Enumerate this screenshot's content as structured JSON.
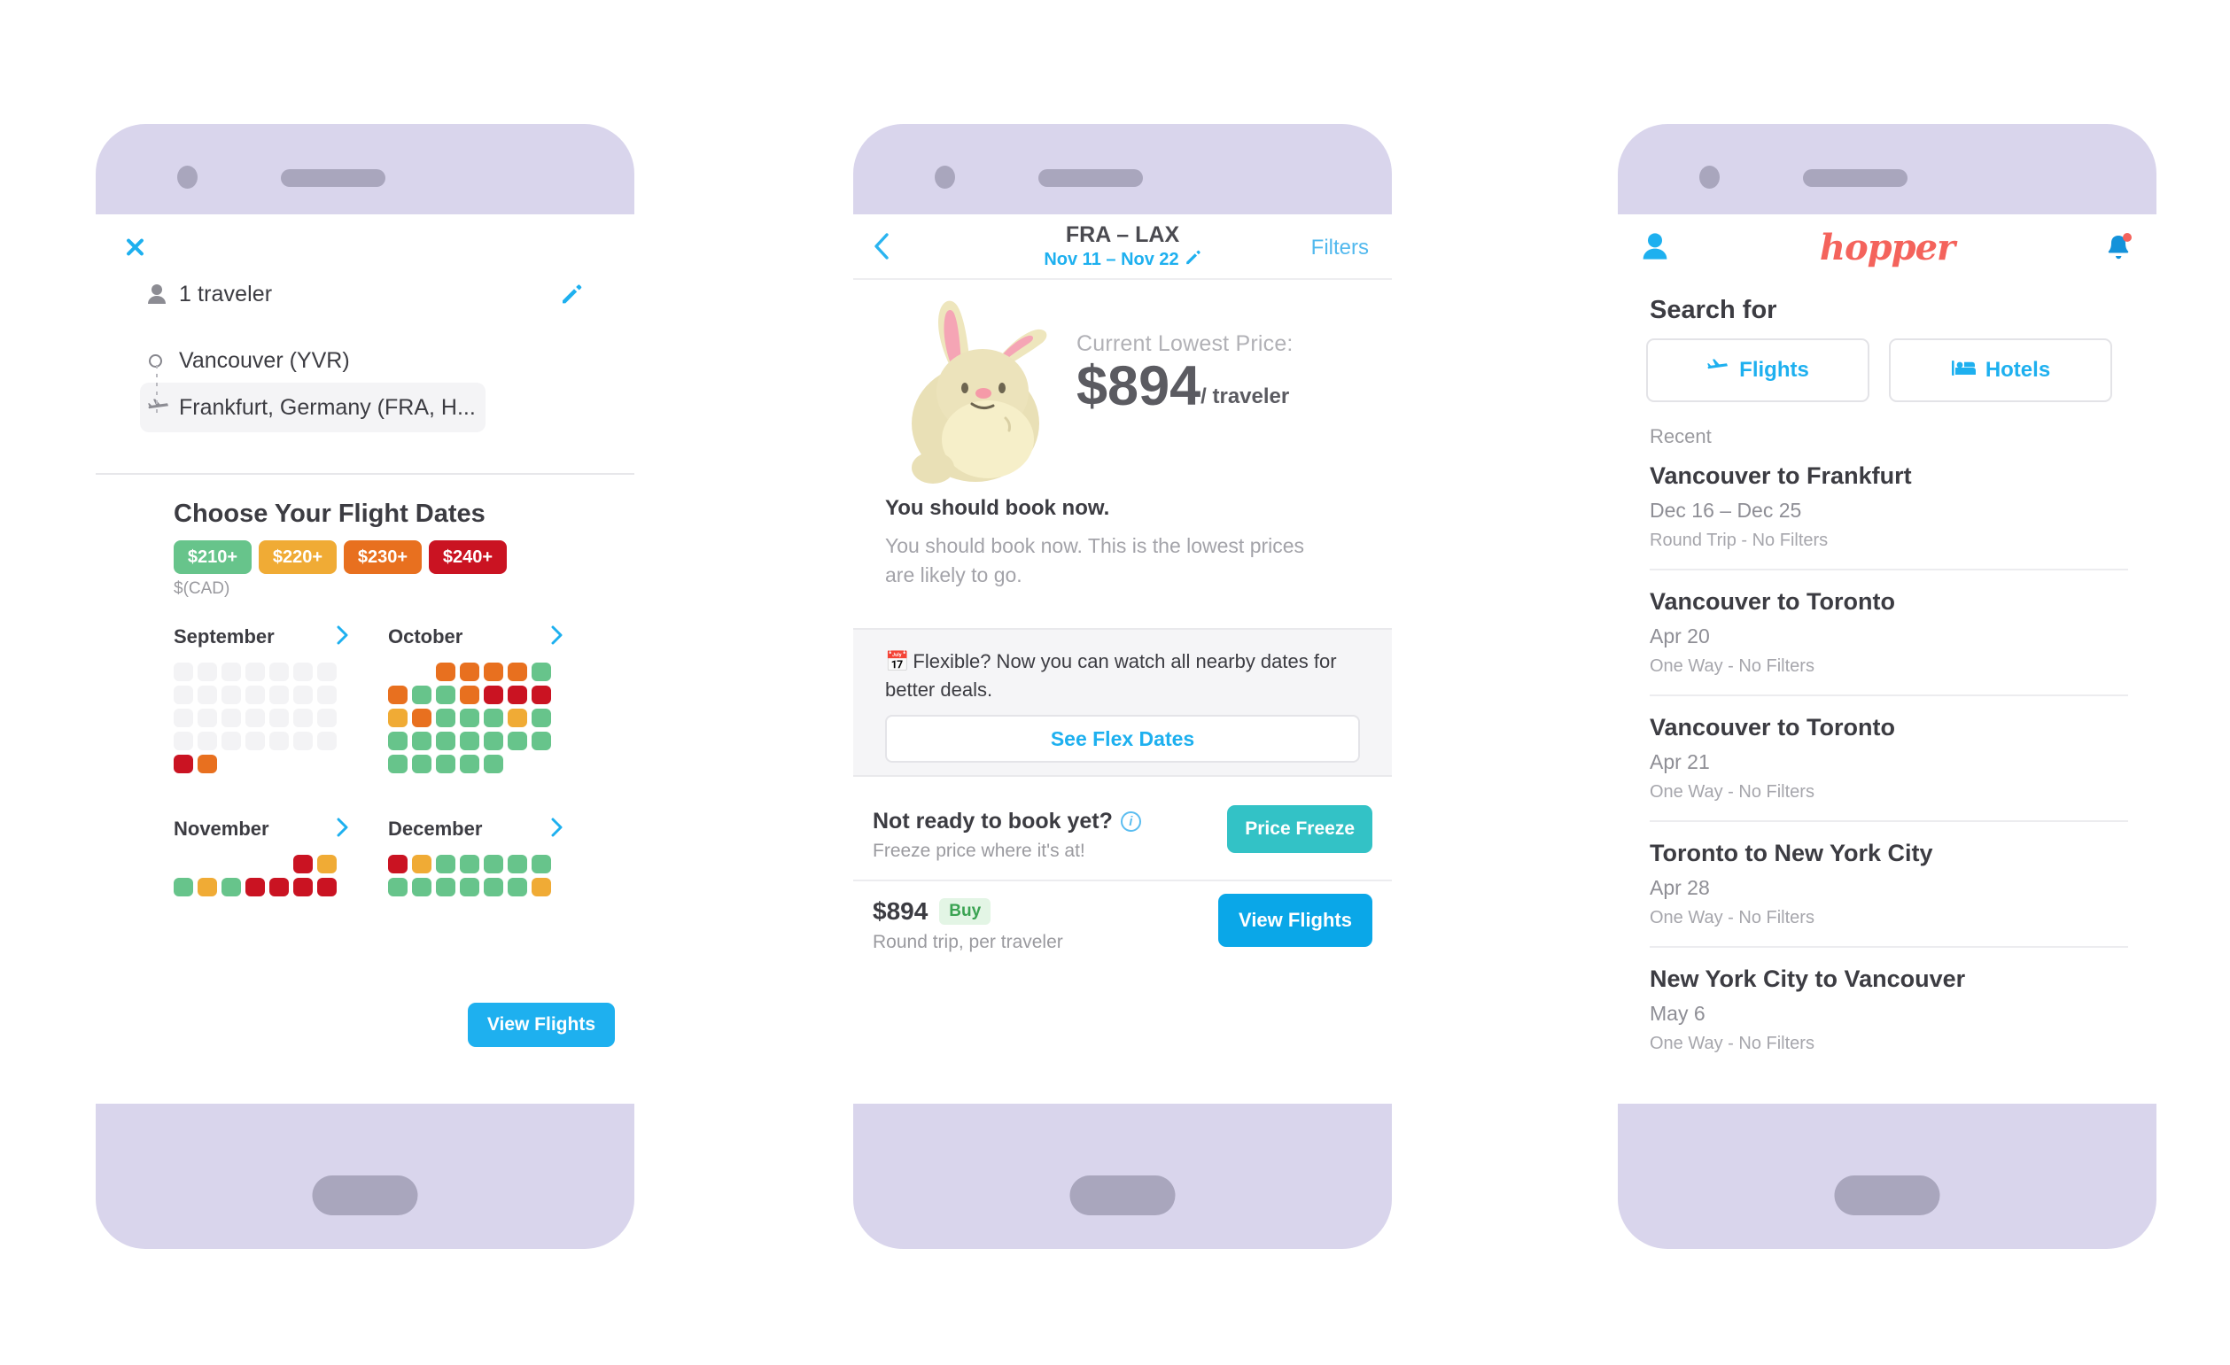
{
  "phone1": {
    "close_icon": "close-icon",
    "traveler": {
      "label": "1 traveler",
      "person_icon": "person-icon",
      "edit_icon": "pencil-icon"
    },
    "route": {
      "origin": "Vancouver (YVR)",
      "destination": "Frankfurt, Germany (FRA, H...",
      "origin_icon": "circle-icon",
      "dest_icon": "airplane-icon"
    },
    "calendar_title": "Choose Your Flight Dates",
    "legend": [
      {
        "label": "$210+",
        "color": "#67c48b"
      },
      {
        "label": "$220+",
        "color": "#f0ab35"
      },
      {
        "label": "$230+",
        "color": "#e8701f"
      },
      {
        "label": "$240+",
        "color": "#ca1322"
      }
    ],
    "currency_note": "$(CAD)",
    "months": [
      {
        "name": "September",
        "chevron_icon": "chevron-right-icon",
        "rows": [
          [
            "empty",
            "empty",
            "empty",
            "empty",
            "empty",
            "empty",
            "empty"
          ],
          [
            "empty",
            "empty",
            "empty",
            "empty",
            "empty",
            "empty",
            "empty"
          ],
          [
            "empty",
            "empty",
            "empty",
            "empty",
            "empty",
            "empty",
            "empty"
          ],
          [
            "empty",
            "empty",
            "empty",
            "empty",
            "empty",
            "empty",
            "empty"
          ],
          [
            "red",
            "orange",
            "blank",
            "blank",
            "blank",
            "blank",
            "blank"
          ]
        ]
      },
      {
        "name": "October",
        "chevron_icon": "chevron-right-icon",
        "rows": [
          [
            "blank",
            "blank",
            "orange",
            "orange",
            "orange",
            "orange",
            "green"
          ],
          [
            "orange",
            "green",
            "green",
            "orange",
            "red",
            "red",
            "red"
          ],
          [
            "yellow",
            "orange",
            "green",
            "green",
            "green",
            "yellow",
            "green"
          ],
          [
            "green",
            "green",
            "green",
            "green",
            "green",
            "green",
            "green"
          ],
          [
            "green",
            "green",
            "green",
            "green",
            "green",
            "blank",
            "blank"
          ]
        ]
      },
      {
        "name": "November",
        "chevron_icon": "chevron-right-icon",
        "rows": [
          [
            "blank",
            "blank",
            "blank",
            "blank",
            "blank",
            "red",
            "yellow"
          ],
          [
            "green",
            "yellow",
            "green",
            "red",
            "red",
            "red",
            "red"
          ]
        ]
      },
      {
        "name": "December",
        "chevron_icon": "chevron-right-icon",
        "rows": [
          [
            "red",
            "yellow",
            "green",
            "green",
            "green",
            "green",
            "green"
          ],
          [
            "green",
            "green",
            "green",
            "green",
            "green",
            "green",
            "yellow"
          ]
        ]
      }
    ],
    "view_flights_label": "View Flights"
  },
  "phone2": {
    "header": {
      "back_icon": "chevron-left-icon",
      "title": "FRA – LAX",
      "dates": "Nov 11 – Nov 22",
      "edit_icon": "pencil-icon",
      "filters_label": "Filters"
    },
    "price": {
      "caption": "Current Lowest Price:",
      "amount": "$894",
      "unit": "/ traveler",
      "mascot_icon": "bunny-mascot-icon"
    },
    "advice": {
      "title": "You should book now.",
      "body": "You should book now. This is the lowest prices are likely to go."
    },
    "flex": {
      "calendar_icon": "calendar-icon",
      "text": "Flexible? Now you can watch all nearby dates for better deals.",
      "button_label": "See Flex Dates"
    },
    "freeze": {
      "title": "Not ready to book yet?",
      "info_icon": "info-icon",
      "subtitle": "Freeze price where it's at!",
      "button_label": "Price Freeze"
    },
    "buy": {
      "price": "$894",
      "badge": "Buy",
      "subtitle": "Round trip, per traveler",
      "button_label": "View Flights"
    }
  },
  "phone3": {
    "header": {
      "profile_icon": "person-icon",
      "logo": "hopper",
      "bell_icon": "notification-bell-icon"
    },
    "search_for_label": "Search for",
    "search_buttons": [
      {
        "label": "Flights",
        "icon": "airplane-icon"
      },
      {
        "label": "Hotels",
        "icon": "bed-icon"
      }
    ],
    "recent_label": "Recent",
    "recent_items": [
      {
        "title": "Vancouver to Frankfurt",
        "date": "Dec 16 – Dec 25",
        "meta": "Round Trip - No Filters"
      },
      {
        "title": "Vancouver to Toronto",
        "date": "Apr 20",
        "meta": "One Way - No Filters"
      },
      {
        "title": "Vancouver to Toronto",
        "date": "Apr 21",
        "meta": "One Way - No Filters"
      },
      {
        "title": "Toronto to New York City",
        "date": "Apr 28",
        "meta": "One Way - No Filters"
      },
      {
        "title": "New York City to Vancouver",
        "date": "May 6",
        "meta": "One Way - No Filters"
      }
    ]
  },
  "colors": {
    "accent_blue": "#1eb0ef",
    "brand_red": "#f4635c",
    "teal": "#33c2c6",
    "phone_frame": "#d9d5ec",
    "green": "#67c48b",
    "yellow": "#f0ab35",
    "orange": "#e8701f",
    "red": "#ca1322"
  }
}
